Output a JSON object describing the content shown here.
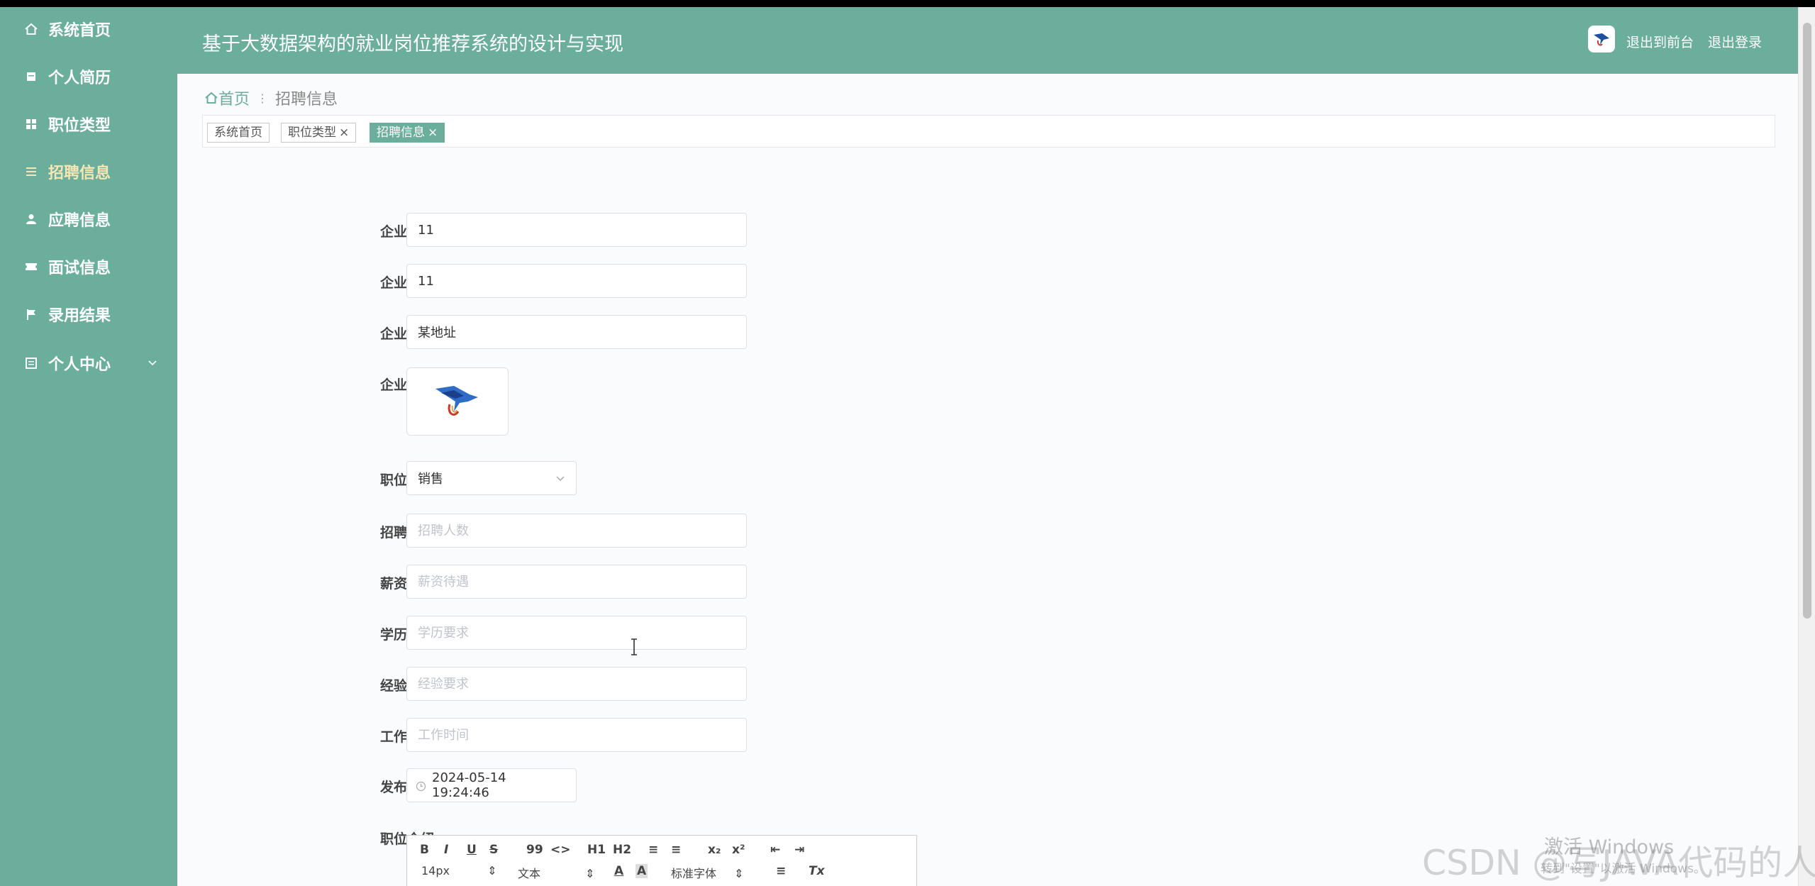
{
  "sidebar": {
    "items": [
      {
        "label": "系统首页"
      },
      {
        "label": "个人简历"
      },
      {
        "label": "职位类型"
      },
      {
        "label": "招聘信息"
      },
      {
        "label": "应聘信息"
      },
      {
        "label": "面试信息"
      },
      {
        "label": "录用结果"
      },
      {
        "label": "个人中心"
      }
    ],
    "active_index": 3,
    "accent": "#6aae9b",
    "active_color": "#f5e6b5"
  },
  "header": {
    "title": "基于大数据架构的就业岗位推荐系统的设计与实现",
    "front_link": "退出到前台",
    "logout_link": "退出登录"
  },
  "breadcrumb": {
    "home": "首页",
    "current": "招聘信息"
  },
  "tags": [
    {
      "label": "系统首页",
      "closable": false
    },
    {
      "label": "职位类型",
      "closable": true
    },
    {
      "label": "招聘信息",
      "closable": true
    }
  ],
  "close_glyph": "×",
  "form": {
    "company_account": {
      "label": "企业账号",
      "value": "11"
    },
    "company_name": {
      "label": "企业名称",
      "value": "11"
    },
    "company_address": {
      "label": "企业地址",
      "value": "某地址"
    },
    "company_image": {
      "label": "企业图片"
    },
    "job_type": {
      "label": "职位类型",
      "value": "销售"
    },
    "headcount": {
      "label": "招聘人数",
      "placeholder": "招聘人数"
    },
    "salary": {
      "label": "薪资待遇",
      "placeholder": "薪资待遇"
    },
    "education": {
      "label": "学历要求",
      "placeholder": "学历要求"
    },
    "experience": {
      "label": "经验要求",
      "placeholder": "经验要求"
    },
    "work_time": {
      "label": "工作时间",
      "placeholder": "工作时间"
    },
    "publish_time": {
      "label": "发布时间",
      "value": "2024-05-14 19:24:46"
    },
    "job_intro": {
      "label": "职位介绍"
    }
  },
  "editor_toolbar": {
    "row1": [
      "B",
      "I",
      "U",
      "S",
      "99",
      "<>",
      "H1",
      "H2",
      "≡",
      "≡",
      "x₂",
      "x²",
      "⇤",
      "⇥"
    ],
    "font_size": "14px",
    "header_select": "文本",
    "font_select": "标准字体",
    "color_a": "A",
    "bg_a": "A",
    "align": "≡",
    "clear": "Tx"
  },
  "overlay": {
    "watermark": "CSDN @写JAVA代码的人",
    "activate_title": "激活 Windows",
    "activate_sub": "转到\"设置\"以激活 Windows。"
  }
}
